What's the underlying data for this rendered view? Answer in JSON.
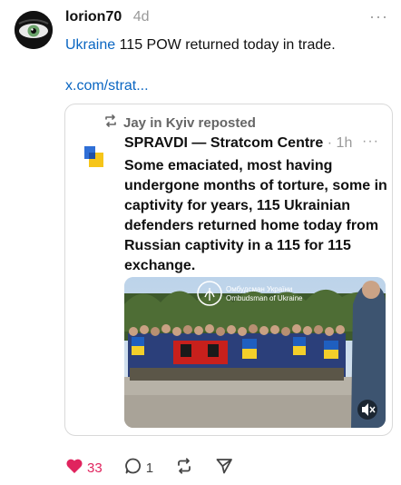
{
  "post": {
    "username": "lorion70",
    "time": "4d",
    "more": "···",
    "tag": "Ukraine",
    "text_rest": " 115 POW returned today in trade.",
    "link": "x.com/strat..."
  },
  "quote": {
    "reposted_by": "Jay in Kyiv reposted",
    "name": "SPRAVDI — Stratcom Centre",
    "time": "· 1h",
    "more": "···",
    "body": "Some emaciated, most having undergone months of torture, some in captivity for years, 115 Ukrainian defenders returned home today from Russian captivity in a 115 for 115 exchange.",
    "media_watermark_line1": "Омбудсман України",
    "media_watermark_line2": "Ombudsman of Ukraine"
  },
  "actions": {
    "likes": "33",
    "replies": "1"
  },
  "colors": {
    "link": "#0a66c2",
    "like": "#e0245e",
    "muted": "#9a9a9a"
  },
  "icons": {
    "like": "heart-icon",
    "reply": "comment-icon",
    "repost": "repost-icon",
    "share": "send-icon",
    "repost_label": "repost-icon",
    "volume": "volume-muted-icon"
  }
}
